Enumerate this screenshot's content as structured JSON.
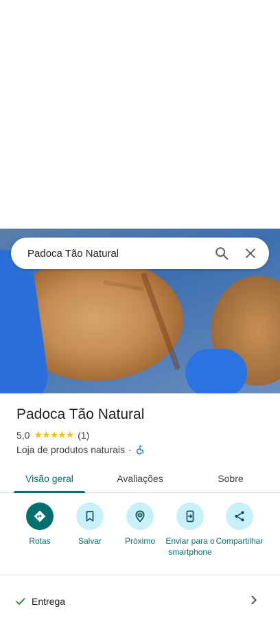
{
  "search": {
    "query": "Padoca Tão Natural"
  },
  "place": {
    "name": "Padoca Tão Natural",
    "rating": "5,0",
    "stars": "★★★★★",
    "review_count": "(1)",
    "category": "Loja de produtos naturais",
    "separator": "·"
  },
  "tabs": [
    {
      "label": "Visão geral",
      "active": true
    },
    {
      "label": "Avaliações",
      "active": false
    },
    {
      "label": "Sobre",
      "active": false
    }
  ],
  "actions": [
    {
      "label": "Rotas",
      "icon": "directions-icon"
    },
    {
      "label": "Salvar",
      "icon": "bookmark-icon"
    },
    {
      "label": "Próximo",
      "icon": "nearby-icon"
    },
    {
      "label": "Enviar para o smartphone",
      "icon": "send-to-phone-icon"
    },
    {
      "label": "Compartilhar",
      "icon": "share-icon"
    }
  ],
  "delivery": {
    "label": "Entrega"
  },
  "colors": {
    "accent": "#00706e",
    "action_bg": "#c8f0f8",
    "star": "#fbbc04",
    "check": "#188038",
    "a11y": "#1a73e8"
  }
}
